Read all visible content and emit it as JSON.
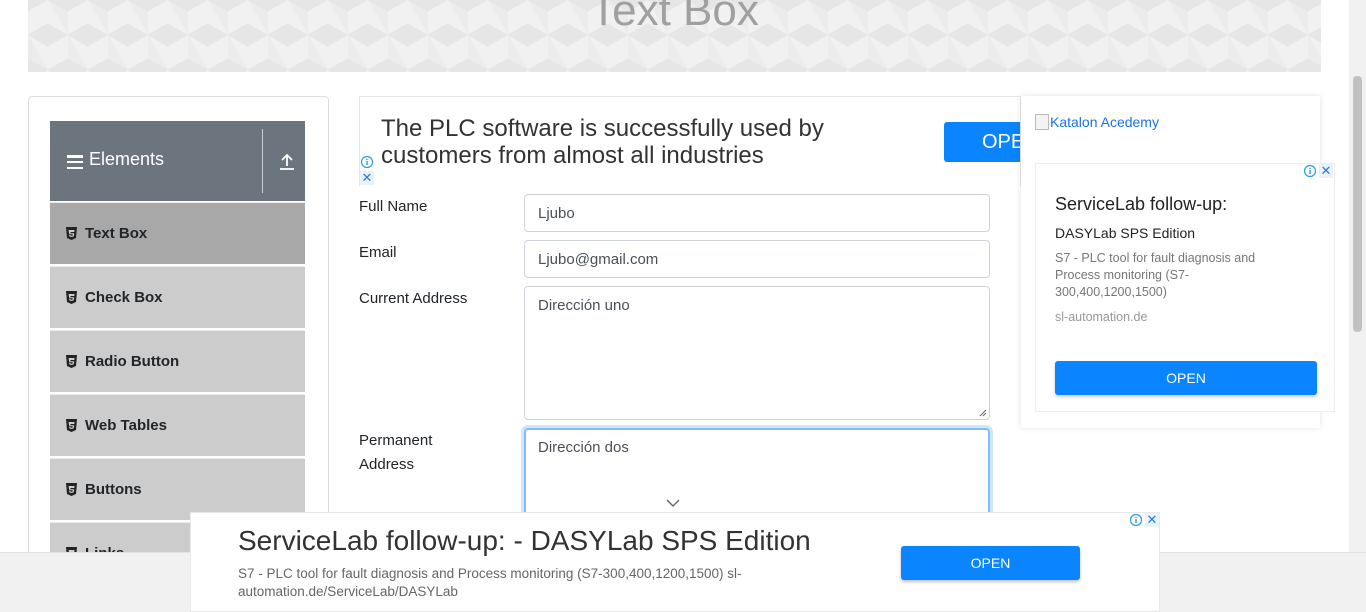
{
  "header": {
    "title": "Text Box"
  },
  "sidebar": {
    "group_title": "Elements",
    "items": [
      {
        "label": "Text Box",
        "active": true
      },
      {
        "label": "Check Box",
        "active": false
      },
      {
        "label": "Radio Button",
        "active": false
      },
      {
        "label": "Web Tables",
        "active": false
      },
      {
        "label": "Buttons",
        "active": false
      },
      {
        "label": "Links",
        "active": false
      }
    ]
  },
  "top_ad": {
    "text": "The PLC software is successfully used by customers from almost all industries",
    "button_label": "OPE"
  },
  "form": {
    "full_name": {
      "label": "Full Name",
      "value": "Ljubo"
    },
    "email": {
      "label": "Email",
      "value": "Ljubo@gmail.com"
    },
    "current_address": {
      "label": "Current Address",
      "value": "Dirección uno"
    },
    "permanent_address": {
      "label": "Permanent Address",
      "label_line1": "Permanent",
      "label_line2": "Address",
      "value": "Dirección dos"
    }
  },
  "right_ad": {
    "image_alt": "Katalon Acedemy",
    "title": "ServiceLab follow-up:",
    "subtitle": "DASYLab SPS Edition",
    "description": "S7 - PLC tool for fault diagnosis and Process monitoring (S7-300,400,1200,1500)",
    "domain": "sl-automation.de",
    "button_label": "OPEN"
  },
  "bottom_ad": {
    "title": "ServiceLab follow-up: - DASYLab SPS Edition",
    "description": "S7 - PLC tool for fault diagnosis and Process monitoring (S7-300,400,1200,1500) sl-automation.de/ServiceLab/DASYLab",
    "button_label": "OPEN"
  },
  "colors": {
    "accent": "#0a84ff",
    "sidebar_header": "#6c757d",
    "sidebar_item": "#cccccc",
    "sidebar_active": "#a8a8a8"
  }
}
